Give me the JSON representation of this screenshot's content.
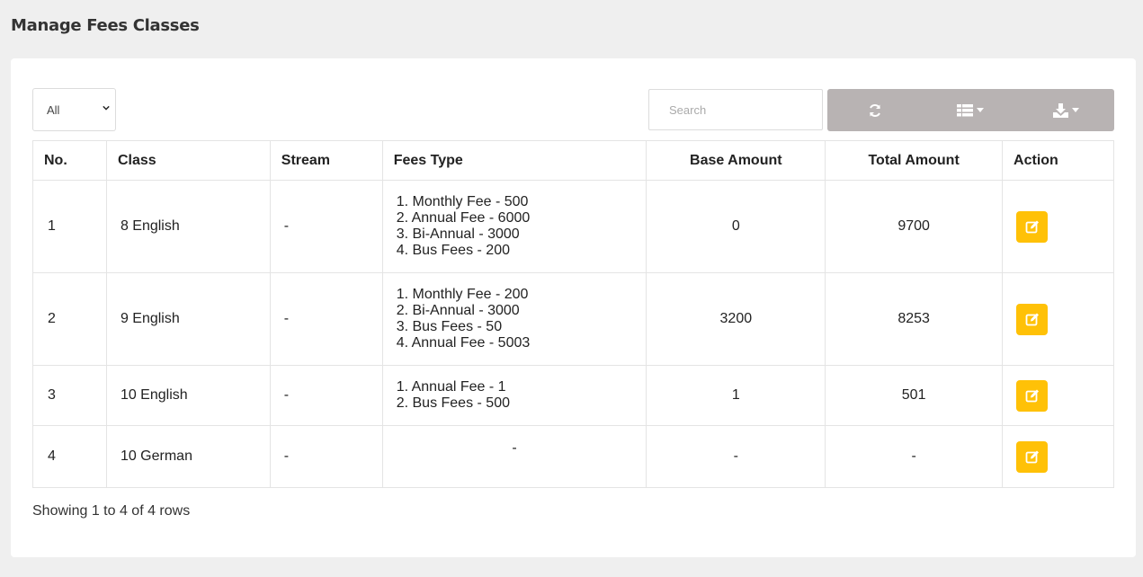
{
  "page": {
    "title": "Manage Fees Classes"
  },
  "toolbar": {
    "filter_value": "All",
    "search_placeholder": "Search",
    "buttons": [
      "refresh-icon",
      "columns-icon",
      "export-icon"
    ],
    "button_group_color": "#b8b3b3"
  },
  "table": {
    "headers": {
      "no": "No.",
      "class": "Class",
      "stream": "Stream",
      "fees_type": "Fees Type",
      "base_amount": "Base Amount",
      "total_amount": "Total Amount",
      "action": "Action"
    },
    "rows": [
      {
        "no": "1",
        "class": "8 English",
        "stream": "-",
        "fees": [
          "1. Monthly Fee - 500",
          "2. Annual Fee - 6000",
          "3. Bi-Annual - 3000",
          "4. Bus Fees - 200"
        ],
        "base_amount": "0",
        "total_amount": "9700"
      },
      {
        "no": "2",
        "class": "9 English",
        "stream": "-",
        "fees": [
          "1. Monthly Fee - 200",
          "2. Bi-Annual - 3000",
          "3. Bus Fees - 50",
          "4. Annual Fee - 5003"
        ],
        "base_amount": "3200",
        "total_amount": "8253"
      },
      {
        "no": "3",
        "class": "10 English",
        "stream": "-",
        "fees": [
          "1. Annual Fee - 1",
          "2. Bus Fees - 500"
        ],
        "base_amount": "1",
        "total_amount": "501"
      },
      {
        "no": "4",
        "class": "10 German",
        "stream": "-",
        "fees_empty": "-",
        "base_amount": "-",
        "total_amount": "-"
      }
    ],
    "edit_button_color": "#ffc107"
  },
  "footer": {
    "pagination_text": "Showing 1 to 4 of 4 rows"
  }
}
